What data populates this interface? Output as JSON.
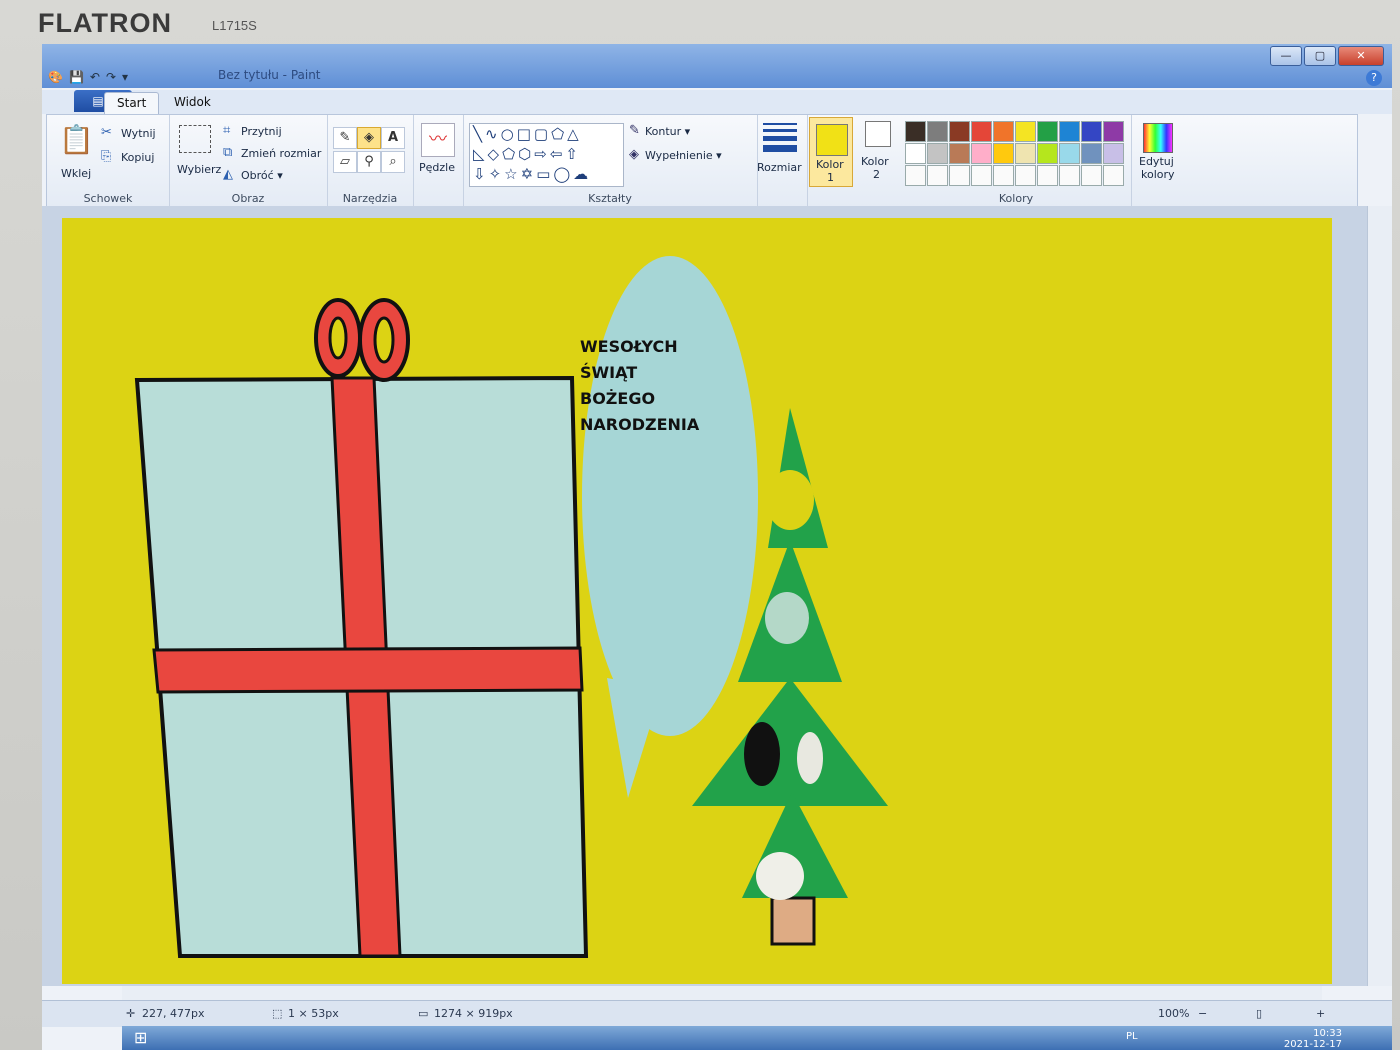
{
  "monitor": {
    "brand": "FLATRON",
    "model": "L1715S"
  },
  "window": {
    "title": "Bez tytułu - Paint",
    "buttons": {
      "minimize": "—",
      "maximize": "▢",
      "close": "✕"
    },
    "help": "?"
  },
  "tabs": {
    "file": "▤ ▾",
    "start": "Start",
    "view": "Widok"
  },
  "ribbon": {
    "clipboard": {
      "paste": "Wklej",
      "cut": "Wytnij",
      "copy": "Kopiuj",
      "label": "Schowek"
    },
    "image": {
      "select": "Wybierz",
      "crop": "Przytnij",
      "resize": "Zmień rozmiar",
      "rotate": "Obróć ▾",
      "label": "Obraz"
    },
    "tools": {
      "label": "Narzędzia"
    },
    "brushes": {
      "label": "Pędzle"
    },
    "shapes": {
      "outline": "Kontur ▾",
      "fill": "Wypełnienie ▾",
      "label": "Kształty"
    },
    "size": {
      "label": "Rozmiar"
    },
    "color1": {
      "label1": "Kolor",
      "label2": "1",
      "value": "#f1e116"
    },
    "color2": {
      "label1": "Kolor",
      "label2": "2",
      "value": "#ffffff"
    },
    "palette": {
      "label": "Kolory",
      "row1": [
        "#3a2e26",
        "#7d7d7d",
        "#8a3a24",
        "#e44638",
        "#f0742a",
        "#f4e423",
        "#23a046",
        "#1e84d4",
        "#3446c4",
        "#8e3aa6"
      ],
      "row2": [
        "#ffffff",
        "#c3c3c3",
        "#b97a57",
        "#ffaec9",
        "#ffc90e",
        "#efe4b0",
        "#b5e61d",
        "#99d9ea",
        "#7092be",
        "#c8bfe7"
      ]
    },
    "edit_colors": {
      "label1": "Edytuj",
      "label2": "kolory"
    }
  },
  "canvas": {
    "background": "#dcd314",
    "greeting": [
      "WESOŁYCH",
      "ŚWIĄT",
      "BOŻEGO",
      "NARODZENIA"
    ]
  },
  "status": {
    "cursor": "227, 477px",
    "selection": "1 × 53px",
    "image_size": "1274 × 919px",
    "zoom": "100%"
  },
  "taskbar": {
    "lang": "PL",
    "time": "10:33",
    "date": "2021-12-17"
  }
}
